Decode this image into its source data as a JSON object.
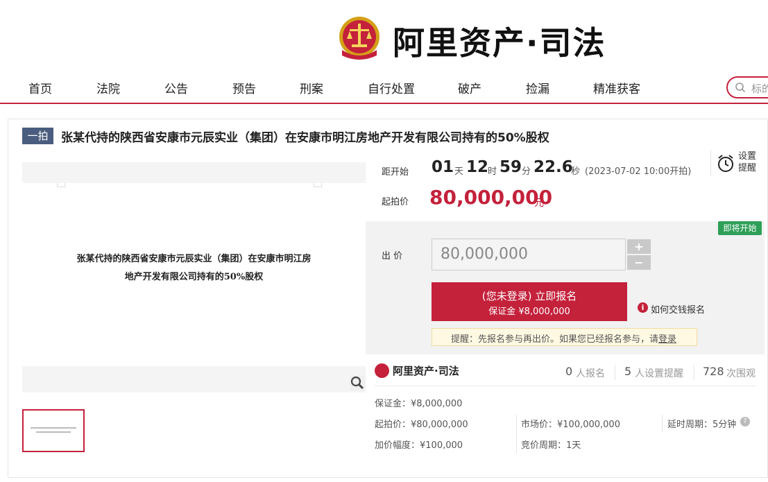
{
  "header": {
    "brand": "阿里资产·司法"
  },
  "nav": {
    "items": [
      "首页",
      "法院",
      "公告",
      "预告",
      "刑案",
      "自行处置",
      "破产",
      "捡漏",
      "精准获客"
    ],
    "search_placeholder": "标的"
  },
  "auction": {
    "round": "一拍",
    "title": "张某代持的陕西省安康市元辰实业（集团）在安康市明江房地产开发有限公司持有的50%股权",
    "image_text_line1": "张某代持的陕西省安康市元辰实业（集团）在安康市明江房",
    "image_text_line2": "地产开发有限公司持有的50%股权",
    "countdown": {
      "label": "距开始",
      "days": "01",
      "days_unit": "天",
      "hours": "12",
      "hours_unit": "时",
      "minutes": "59",
      "minutes_unit": "分",
      "seconds": "22.6",
      "seconds_unit": "秒",
      "start_text": "(2023-07-02 10:00开拍)"
    },
    "reminder": {
      "line1": "设置",
      "line2": "提醒"
    },
    "start_price": {
      "label": "起拍价",
      "value": "80,000,000",
      "unit": "元"
    },
    "status_badge": "即将开始",
    "bid": {
      "label": "出 价",
      "value": "80,000,000",
      "plus": "+",
      "minus": "−",
      "signup_main": "(您未登录) 立即报名",
      "signup_sub": "保证金 ¥8,000,000",
      "howto": "如何交钱报名",
      "tip_prefix": "提醒：先报名参与再出价。如果您已经报名参与，请",
      "tip_link": "登录"
    }
  },
  "stats": {
    "brand": "阿里资产·司法",
    "signups": "0",
    "signups_label": "人报名",
    "reminders": "5",
    "reminders_label": "人设置提醒",
    "views": "728",
    "views_label": "次围观"
  },
  "details": {
    "deposit": "保证金：¥8,000,000",
    "start_price": "起拍价：¥80,000,000",
    "market_price": "市场价：¥100,000,000",
    "delay_period": "延时周期：5分钟",
    "increment": "加价幅度：¥100,000",
    "bid_period": "竞价周期：1天"
  },
  "colors": {
    "accent": "#c4213b",
    "badge_green": "#2e9f58",
    "round_badge": "#4a5d7e"
  }
}
